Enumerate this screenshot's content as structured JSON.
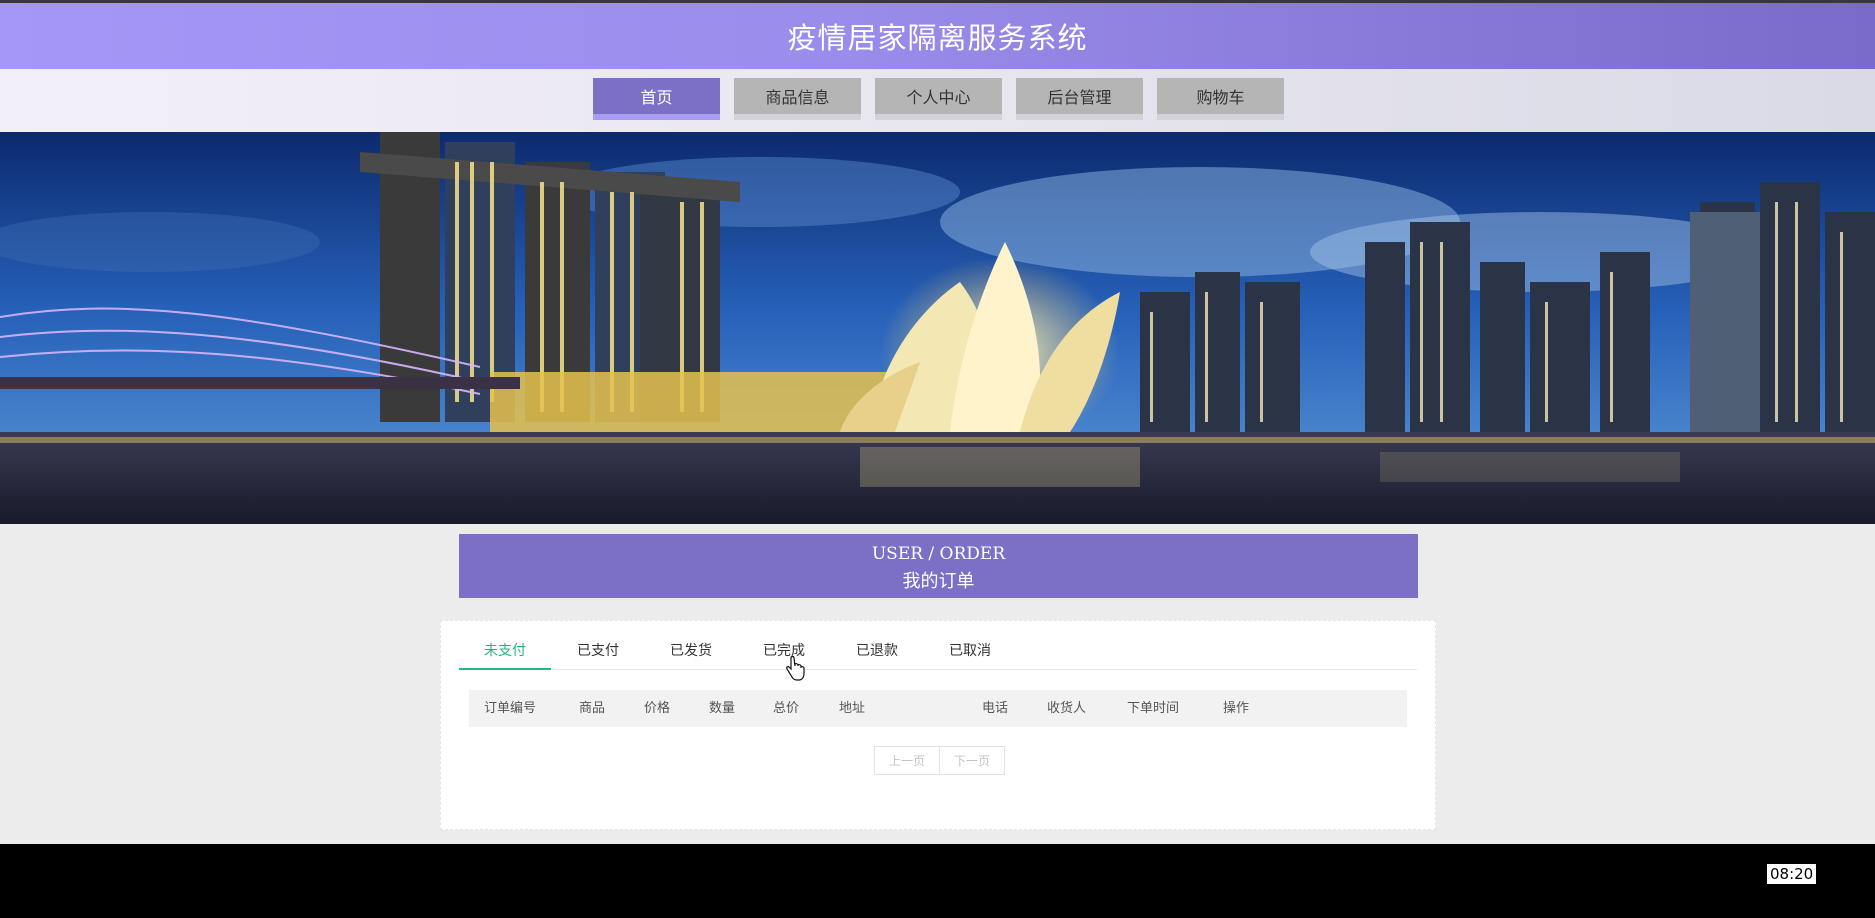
{
  "header": {
    "title": "疫情居家隔离服务系统"
  },
  "nav": {
    "items": [
      {
        "label": "首页",
        "active": true
      },
      {
        "label": "商品信息",
        "active": false
      },
      {
        "label": "个人中心",
        "active": false
      },
      {
        "label": "后台管理",
        "active": false
      },
      {
        "label": "购物车",
        "active": false
      }
    ]
  },
  "order_section": {
    "title_en": "USER / ORDER",
    "title_cn": "我的订单"
  },
  "tabs": [
    {
      "label": "未支付",
      "active": true
    },
    {
      "label": "已支付",
      "active": false
    },
    {
      "label": "已发货",
      "active": false
    },
    {
      "label": "已完成",
      "active": false
    },
    {
      "label": "已退款",
      "active": false
    },
    {
      "label": "已取消",
      "active": false
    }
  ],
  "table": {
    "columns": [
      "订单编号",
      "商品",
      "价格",
      "数量",
      "总价",
      "地址",
      "电话",
      "收货人",
      "下单时间",
      "操作"
    ],
    "rows": []
  },
  "pagination": {
    "prev": "上一页",
    "next": "下一页"
  },
  "status": {
    "time": "08:20"
  },
  "colors": {
    "accent": "#7b6fc6",
    "tab_active": "#21b77d",
    "header_gradient_start": "#a497f7",
    "header_gradient_end": "#7a6ac9"
  }
}
